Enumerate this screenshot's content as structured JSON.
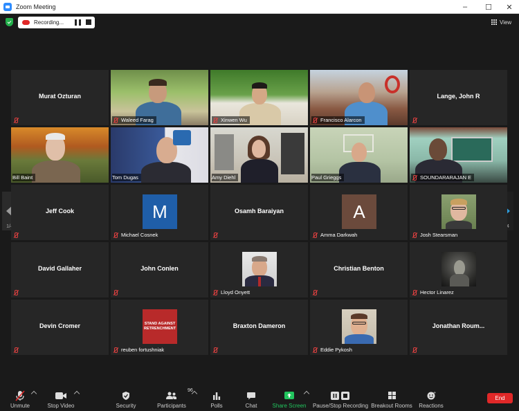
{
  "window": {
    "title": "Zoom Meeting",
    "minimize": "–",
    "maximize": "☐",
    "close": "✕"
  },
  "recording": {
    "label": "Recording..."
  },
  "view": {
    "label": "View"
  },
  "paging": {
    "left": "1/4",
    "right": "1/4"
  },
  "tiles": [
    {
      "name": "Murat Ozturan",
      "type": "name"
    },
    {
      "name": "Waleed Farag",
      "type": "video"
    },
    {
      "name": "Xinwen Wu",
      "type": "video"
    },
    {
      "name": "Francisco Alarcon",
      "type": "video"
    },
    {
      "name": "Lange, John R",
      "type": "name"
    },
    {
      "name": "Bill Baint",
      "type": "video"
    },
    {
      "name": "Tom Dugas",
      "type": "video"
    },
    {
      "name": "Amy Diehl",
      "type": "video",
      "active": true
    },
    {
      "name": "Paul Grieggs",
      "type": "video"
    },
    {
      "name": "SOUNDARARAJAN E",
      "type": "video"
    },
    {
      "name": "Jeff Cook",
      "type": "name"
    },
    {
      "name": "Michael Cosnek",
      "type": "letter",
      "letter": "M",
      "color": "#1f5ea8"
    },
    {
      "name": "Osamh Baraiyan",
      "type": "name"
    },
    {
      "name": "Amma Darkwah",
      "type": "letter",
      "letter": "A",
      "color": "#6b4a3c"
    },
    {
      "name": "Josh Stearsman",
      "type": "photo"
    },
    {
      "name": "David Gallaher",
      "type": "name"
    },
    {
      "name": "John Conlen",
      "type": "name"
    },
    {
      "name": "Lloyd Onyett",
      "type": "photo"
    },
    {
      "name": "Christian Benton",
      "type": "name"
    },
    {
      "name": "Hector Linarez",
      "type": "photo"
    },
    {
      "name": "Devin Cromer",
      "type": "name"
    },
    {
      "name": "reuben fortushniak",
      "type": "poster",
      "poster": "STAND AGAINST RETRENCHMENT"
    },
    {
      "name": "Braxton Dameron",
      "type": "name"
    },
    {
      "name": "Eddie Pykosh",
      "type": "photo"
    },
    {
      "name": "Jonathan  Roum...",
      "type": "name"
    }
  ],
  "toolbar": {
    "unmute": "Unmute",
    "stop_video": "Stop Video",
    "security": "Security",
    "participants": "Participants",
    "participants_count": "96",
    "polls": "Polls",
    "chat": "Chat",
    "share_screen": "Share Screen",
    "pause_stop_recording": "Pause/Stop Recording",
    "breakout_rooms": "Breakout Rooms",
    "reactions": "Reactions",
    "end": "End"
  },
  "colors": {
    "share_green": "#22c55e",
    "end_red": "#e02828",
    "active_speaker": "#f2f05c",
    "arrow_blue": "#2d9cdb"
  }
}
